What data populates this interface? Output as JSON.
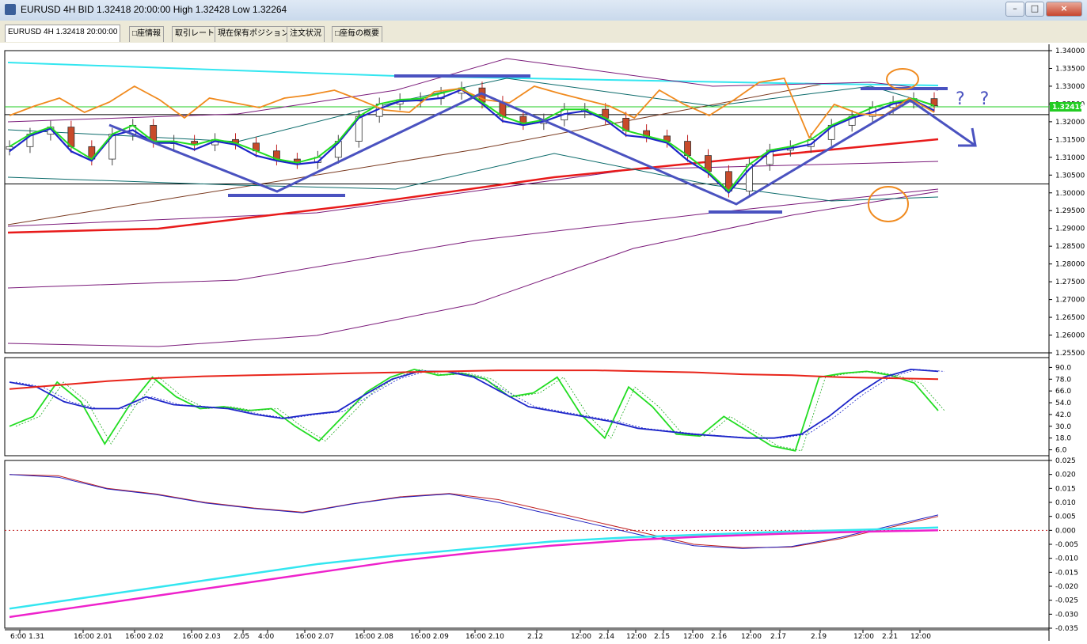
{
  "window": {
    "title": "EURUSD 4H BID 1.32418 20:00:00 High 1.32428 Low 1.32264",
    "buttons": [
      "–",
      "□",
      "×"
    ]
  },
  "tabs": [
    {
      "label": "EURUSD 4H 1.32418 20:00:00",
      "active": true
    },
    {
      "label": "□座情報",
      "active": false
    },
    {
      "label": "取引レート",
      "active": false
    },
    {
      "label": "現在保有ポジション",
      "active": false
    },
    {
      "label": "注文状況",
      "active": false
    },
    {
      "label": "□座毎の概要",
      "active": false
    }
  ],
  "chart_data": [
    {
      "type": "candlestick",
      "symbol": "EURUSD",
      "timeframe": "4H",
      "current_price": "1.32418",
      "ylim": [
        1.255,
        1.34
      ],
      "y_ticks": [
        "1.34000",
        "1.33500",
        "1.33000",
        "1.32500",
        "1.32000",
        "1.31500",
        "1.31000",
        "1.30500",
        "1.30000",
        "1.29500",
        "1.29000",
        "1.28500",
        "1.28000",
        "1.27500",
        "1.27000",
        "1.26500",
        "1.26000",
        "1.25500"
      ],
      "x_tick_labels": [
        "6:00 1.31",
        "16:00 2.01",
        "16:00 2.02",
        "16:00 2.03",
        "2.05",
        "4:00",
        "16:00 2.07",
        "16:00 2.08",
        "16:00 2.09",
        "16:00 2.10",
        "2.12",
        "12:00",
        "2.14",
        "12:00",
        "2.15",
        "12:00",
        "2.16",
        "12:00",
        "2.17",
        "2.19",
        "12:00",
        "2.21",
        "12:00"
      ],
      "price_path": [
        1.313,
        1.3165,
        1.3185,
        1.313,
        1.3095,
        1.3165,
        1.319,
        1.3145,
        1.3145,
        1.3135,
        1.315,
        1.314,
        1.3118,
        1.3095,
        1.3085,
        1.31,
        1.3145,
        1.3215,
        1.325,
        1.3262,
        1.3265,
        1.328,
        1.3295,
        1.3255,
        1.3215,
        1.3195,
        1.3205,
        1.3235,
        1.3235,
        1.321,
        1.3175,
        1.316,
        1.3145,
        1.3105,
        1.306,
        1.3005,
        1.308,
        1.312,
        1.313,
        1.315,
        1.319,
        1.3215,
        1.324,
        1.3255,
        1.3265,
        1.3245
      ],
      "annotations": [
        "? ?"
      ],
      "horizontal_lines": [
        1.3242,
        1.322,
        1.3025
      ]
    },
    {
      "type": "line",
      "name": "stochastic",
      "ylim": [
        0,
        100
      ],
      "y_ticks": [
        "90.0",
        "78.0",
        "66.0",
        "54.0",
        "42.0",
        "30.0",
        "18.0",
        "6.0"
      ],
      "series": [
        {
          "color": "#22dd22",
          "values": [
            30,
            40,
            75,
            55,
            12,
            50,
            80,
            60,
            48,
            50,
            46,
            48,
            30,
            15,
            40,
            65,
            80,
            88,
            82,
            84,
            78,
            60,
            64,
            80,
            42,
            18,
            70,
            50,
            22,
            20,
            40,
            25,
            10,
            5,
            80,
            84,
            86,
            82,
            74,
            46
          ]
        },
        {
          "color": "#1d25c9",
          "values": [
            75,
            70,
            55,
            48,
            48,
            60,
            52,
            50,
            48,
            42,
            38,
            42,
            45,
            62,
            78,
            86,
            86,
            80,
            65,
            50,
            45,
            40,
            35,
            28,
            25,
            22,
            20,
            18,
            18,
            22,
            40,
            62,
            80,
            88,
            86
          ]
        },
        {
          "color": "#e8241a",
          "values": [
            68,
            72,
            76,
            79,
            81,
            82,
            83,
            84,
            85,
            86,
            87,
            87,
            87,
            86,
            85,
            83,
            82,
            80,
            79,
            78
          ]
        }
      ]
    },
    {
      "type": "line",
      "name": "macd",
      "ylim": [
        -0.035,
        0.025
      ],
      "y_ticks": [
        "0.025",
        "0.020",
        "0.015",
        "0.010",
        "0.005",
        "0.000",
        "-0.005",
        "-0.010",
        "-0.015",
        "-0.020",
        "-0.025",
        "-0.030",
        "-0.035"
      ],
      "series": [
        {
          "color": "#c02020",
          "values": [
            0.02,
            0.0195,
            0.015,
            0.013,
            0.01,
            0.008,
            0.0065,
            0.0095,
            0.012,
            0.0132,
            0.011,
            0.007,
            0.003,
            -0.001,
            -0.005,
            -0.0062,
            -0.006,
            -0.003,
            0.001,
            0.005
          ]
        },
        {
          "color": "#2020c0",
          "values": [
            0.02,
            0.019,
            0.0148,
            0.0128,
            0.0098,
            0.0078,
            0.0063,
            0.0094,
            0.0118,
            0.013,
            0.01,
            0.006,
            0.002,
            -0.002,
            -0.0055,
            -0.0065,
            -0.0058,
            -0.0025,
            0.0015,
            0.0055
          ]
        },
        {
          "color": "#33e6f0",
          "values": [
            -0.028,
            -0.024,
            -0.02,
            -0.016,
            -0.012,
            -0.009,
            -0.0065,
            -0.004,
            -0.0025,
            -0.0015,
            -0.0005,
            0.0002,
            0.001
          ]
        },
        {
          "color": "#ee22cc",
          "values": [
            -0.031,
            -0.027,
            -0.023,
            -0.019,
            -0.015,
            -0.011,
            -0.008,
            -0.0055,
            -0.0035,
            -0.0022,
            -0.0012,
            -0.0005,
            0.0
          ]
        }
      ]
    }
  ]
}
